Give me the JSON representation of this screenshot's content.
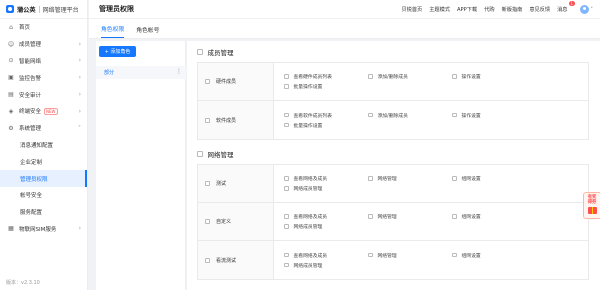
{
  "brand": {
    "name": "蒲公英",
    "subtitle": "网络管理平台"
  },
  "sidebar": {
    "items": [
      {
        "label": "首页",
        "icon": "home-icon",
        "glyph": "⌂",
        "arrow": "",
        "badge": ""
      },
      {
        "label": "成员管理",
        "icon": "user-icon",
        "glyph": "☺",
        "arrow": "›",
        "badge": ""
      },
      {
        "label": "智能网络",
        "icon": "network-icon",
        "glyph": "⊙",
        "arrow": "›",
        "badge": ""
      },
      {
        "label": "监控告警",
        "icon": "monitor-icon",
        "glyph": "▣",
        "arrow": "›",
        "badge": ""
      },
      {
        "label": "安全审计",
        "icon": "audit-icon",
        "glyph": "▤",
        "arrow": "›",
        "badge": ""
      },
      {
        "label": "终端安全",
        "icon": "shield-icon",
        "glyph": "◈",
        "arrow": "›",
        "badge": "NEW"
      },
      {
        "label": "系统管理",
        "icon": "settings-icon",
        "glyph": "⚙",
        "arrow": "˅",
        "badge": ""
      }
    ],
    "subitems": [
      {
        "label": "消息通知配置",
        "active": false
      },
      {
        "label": "企业定制",
        "active": false
      },
      {
        "label": "管理员权限",
        "active": true
      },
      {
        "label": "帐号安全",
        "active": false
      },
      {
        "label": "服务配置",
        "active": false
      }
    ],
    "last_item": {
      "label": "物联网SIM服务",
      "icon": "sim-card-icon",
      "glyph": "▦",
      "arrow": "›"
    },
    "version": "版本：v2.3.10"
  },
  "header": {
    "title": "管理员权限",
    "links": [
      "贝锐首页",
      "主题模式",
      "APP下载",
      "代购",
      "新版指南",
      "意见反馈"
    ],
    "messages": {
      "label": "消息",
      "count": "1"
    },
    "user_caret": "˅"
  },
  "tabs": [
    {
      "label": "角色权限",
      "active": true
    },
    {
      "label": "角色帐号",
      "active": false
    }
  ],
  "roles": {
    "add_button": "+ 添加角色",
    "items": [
      {
        "label": "部分",
        "more": "⋮"
      }
    ]
  },
  "permissions": [
    {
      "title": "成员管理",
      "rows": [
        {
          "label": "硬件成员",
          "options": [
            "查看硬件成员列表",
            "添加/删除成员",
            "操作设置",
            "批量操作设置"
          ]
        },
        {
          "label": "软件成员",
          "options": [
            "查看软件成员列表",
            "添加/删除成员",
            "操作设置",
            "批量操作设置"
          ]
        }
      ]
    },
    {
      "title": "网络管理",
      "rows": [
        {
          "label": "测试",
          "options": [
            "查看网络及成员",
            "网络管理",
            "组网设置",
            "网络成员管理"
          ]
        },
        {
          "label": "自定义",
          "options": [
            "查看网络及成员",
            "网络管理",
            "组网设置",
            "网络成员管理"
          ]
        },
        {
          "label": "看流测试",
          "options": [
            "查看网络及成员",
            "网络管理",
            "组网设置",
            "网络成员管理"
          ]
        }
      ]
    }
  ],
  "promo": {
    "line1": "有奖",
    "line2": "得券"
  },
  "colors": {
    "primary": "#1677ff",
    "danger": "#ff4d4f"
  }
}
